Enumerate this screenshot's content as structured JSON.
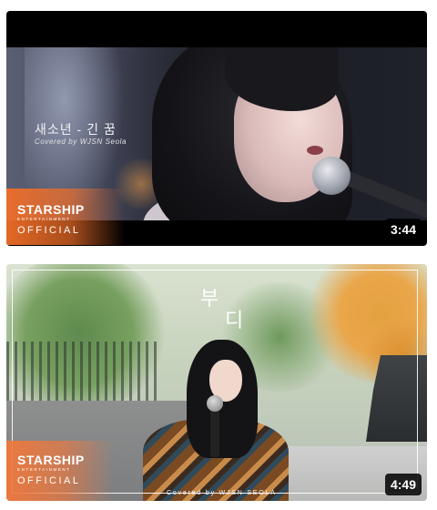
{
  "videos": [
    {
      "title": "새소년 - 긴 꿈",
      "credit": "Covered by WJSN Seola",
      "duration": "3:44",
      "brand": {
        "name": "STARSHIP",
        "sub": "ENTERTAINMENT",
        "tag": "OFFICIAL"
      }
    },
    {
      "title_line1": "부",
      "title_line2": "디",
      "credit": "Covered by WJSN SEOLA",
      "duration": "4:49",
      "brand": {
        "name": "STARSHIP",
        "sub": "ENTERTAINMENT",
        "tag": "OFFICIAL"
      }
    }
  ],
  "colors": {
    "brand_flare": "#f06e28",
    "badge_bg": "#000000"
  }
}
